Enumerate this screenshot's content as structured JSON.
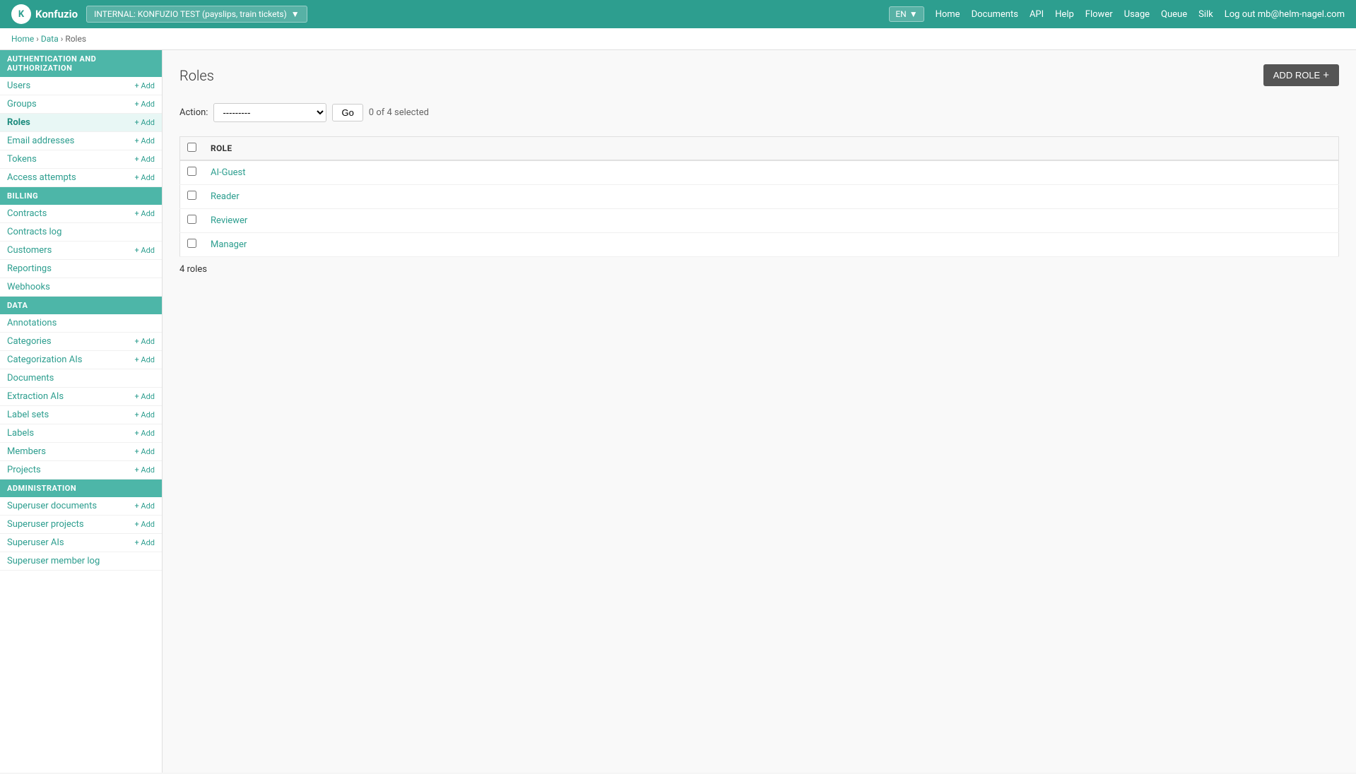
{
  "topnav": {
    "logo_text": "Konfuzio",
    "logo_abbr": "K",
    "env_label": "INTERNAL: KONFUZIO TEST (payslips, train tickets)",
    "lang": "EN",
    "nav_links": [
      {
        "label": "Home",
        "name": "home-link"
      },
      {
        "label": "Documents",
        "name": "documents-link"
      },
      {
        "label": "API",
        "name": "api-link"
      },
      {
        "label": "Help",
        "name": "help-link"
      },
      {
        "label": "Flower",
        "name": "flower-link"
      },
      {
        "label": "Usage",
        "name": "usage-link"
      },
      {
        "label": "Queue",
        "name": "queue-link"
      },
      {
        "label": "Silk",
        "name": "silk-link"
      },
      {
        "label": "Log out mb@helm-nagel.com",
        "name": "logout-link"
      }
    ]
  },
  "breadcrumb": {
    "items": [
      {
        "label": "Home",
        "href": "#"
      },
      {
        "label": "Data",
        "href": "#"
      },
      {
        "label": "Roles",
        "href": "#"
      }
    ]
  },
  "sidebar": {
    "sections": [
      {
        "header": "AUTHENTICATION AND AUTHORIZATION",
        "items": [
          {
            "label": "Users",
            "add": true,
            "active": false,
            "name": "sidebar-item-users"
          },
          {
            "label": "Groups",
            "add": true,
            "active": false,
            "name": "sidebar-item-groups"
          },
          {
            "label": "Roles",
            "add": true,
            "active": true,
            "name": "sidebar-item-roles"
          },
          {
            "label": "Email addresses",
            "add": true,
            "active": false,
            "name": "sidebar-item-email-addresses"
          },
          {
            "label": "Tokens",
            "add": true,
            "active": false,
            "name": "sidebar-item-tokens"
          },
          {
            "label": "Access attempts",
            "add": true,
            "active": false,
            "name": "sidebar-item-access-attempts"
          }
        ]
      },
      {
        "header": "BILLING",
        "items": [
          {
            "label": "Contracts",
            "add": true,
            "active": false,
            "name": "sidebar-item-contracts"
          },
          {
            "label": "Contracts log",
            "add": false,
            "active": false,
            "name": "sidebar-item-contracts-log"
          },
          {
            "label": "Customers",
            "add": true,
            "active": false,
            "name": "sidebar-item-customers"
          },
          {
            "label": "Reportings",
            "add": false,
            "active": false,
            "name": "sidebar-item-reportings"
          },
          {
            "label": "Webhooks",
            "add": false,
            "active": false,
            "name": "sidebar-item-webhooks"
          }
        ]
      },
      {
        "header": "DATA",
        "items": [
          {
            "label": "Annotations",
            "add": false,
            "active": false,
            "name": "sidebar-item-annotations"
          },
          {
            "label": "Categories",
            "add": true,
            "active": false,
            "name": "sidebar-item-categories"
          },
          {
            "label": "Categorization AIs",
            "add": true,
            "active": false,
            "name": "sidebar-item-categorization-ais"
          },
          {
            "label": "Documents",
            "add": false,
            "active": false,
            "name": "sidebar-item-documents"
          },
          {
            "label": "Extraction AIs",
            "add": true,
            "active": false,
            "name": "sidebar-item-extraction-ais"
          },
          {
            "label": "Label sets",
            "add": true,
            "active": false,
            "name": "sidebar-item-label-sets"
          },
          {
            "label": "Labels",
            "add": true,
            "active": false,
            "name": "sidebar-item-labels"
          },
          {
            "label": "Members",
            "add": true,
            "active": false,
            "name": "sidebar-item-members"
          },
          {
            "label": "Projects",
            "add": true,
            "active": false,
            "name": "sidebar-item-projects"
          }
        ]
      },
      {
        "header": "ADMINISTRATION",
        "items": [
          {
            "label": "Superuser documents",
            "add": true,
            "active": false,
            "name": "sidebar-item-superuser-documents"
          },
          {
            "label": "Superuser projects",
            "add": true,
            "active": false,
            "name": "sidebar-item-superuser-projects"
          },
          {
            "label": "Superuser AIs",
            "add": true,
            "active": false,
            "name": "sidebar-item-superuser-ais"
          },
          {
            "label": "Superuser member log",
            "add": false,
            "active": false,
            "name": "sidebar-item-superuser-member-log"
          }
        ]
      }
    ]
  },
  "main": {
    "page_title": "Roles",
    "add_role_btn": "ADD ROLE",
    "action_label": "Action:",
    "action_placeholder": "---------",
    "go_btn": "Go",
    "selected_count": "0 of 4 selected",
    "table": {
      "col_header": "ROLE",
      "rows": [
        {
          "label": "AI-Guest"
        },
        {
          "label": "Reader"
        },
        {
          "label": "Reviewer"
        },
        {
          "label": "Manager"
        }
      ]
    },
    "row_count": "4 roles"
  },
  "colors": {
    "primary": "#2d9e8f",
    "sidebar_header": "#4db6a8",
    "add_role_btn": "#555555"
  }
}
